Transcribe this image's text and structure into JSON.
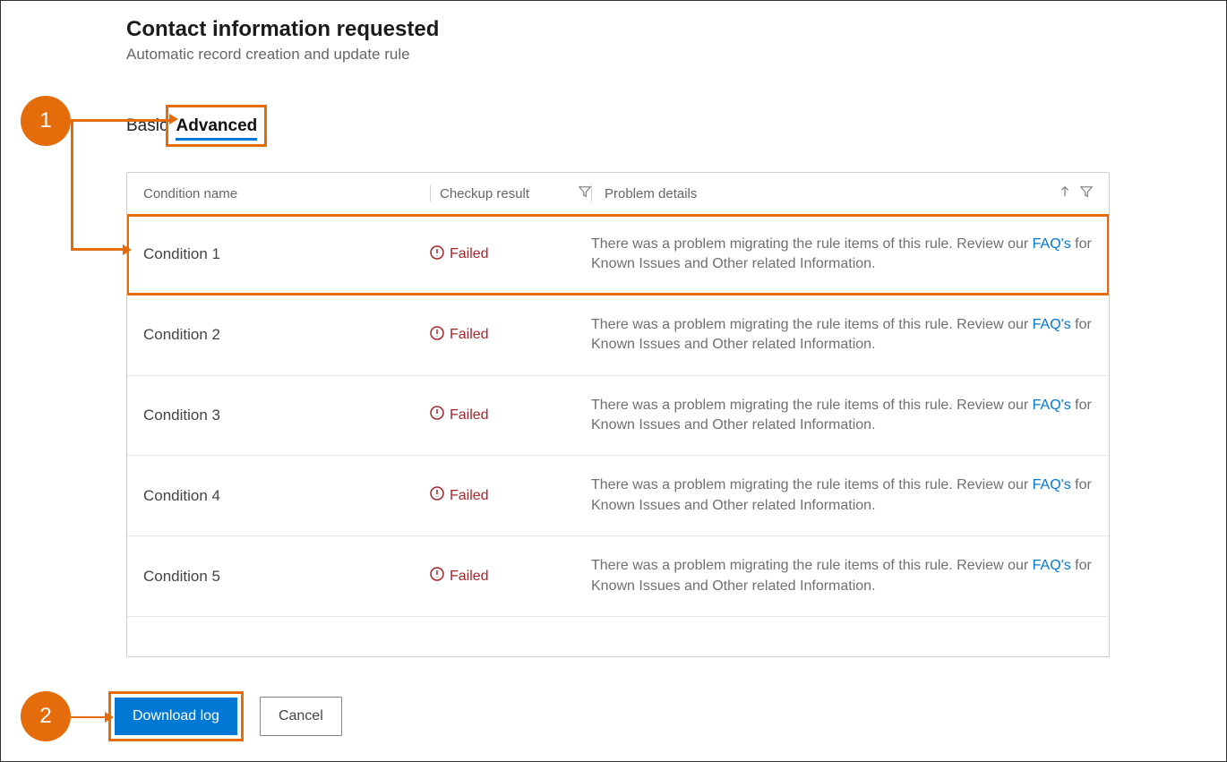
{
  "header": {
    "title": "Contact information requested",
    "subtitle": "Automatic record creation and update rule"
  },
  "tabs": {
    "basic": "Basic",
    "advanced": "Advanced"
  },
  "grid": {
    "columns": {
      "condition": "Condition name",
      "result": "Checkup result",
      "details": "Problem details"
    },
    "rows": [
      {
        "condition": "Condition 1",
        "result": "Failed",
        "details_pre": "There was a problem migrating the rule items of this rule. Review our ",
        "faq": "FAQ's",
        "details_post": " for Known Issues and Other related Information."
      },
      {
        "condition": "Condition 2",
        "result": "Failed",
        "details_pre": "There was a problem migrating the rule items of this rule. Review our ",
        "faq": "FAQ's",
        "details_post": " for Known Issues and Other related Information."
      },
      {
        "condition": "Condition 3",
        "result": "Failed",
        "details_pre": "There was a problem migrating the rule items of this rule. Review our ",
        "faq": "FAQ's",
        "details_post": " for Known Issues and Other related Information."
      },
      {
        "condition": "Condition 4",
        "result": "Failed",
        "details_pre": "There was a problem migrating the rule items of this rule. Review our ",
        "faq": "FAQ's",
        "details_post": " for Known Issues and Other related Information."
      },
      {
        "condition": "Condition 5",
        "result": "Failed",
        "details_pre": "There was a problem migrating the rule items of this rule. Review our ",
        "faq": "FAQ's",
        "details_post": " for Known Issues and Other related Information."
      }
    ]
  },
  "actions": {
    "download": "Download log",
    "cancel": "Cancel"
  },
  "callouts": {
    "one": "1",
    "two": "2"
  }
}
